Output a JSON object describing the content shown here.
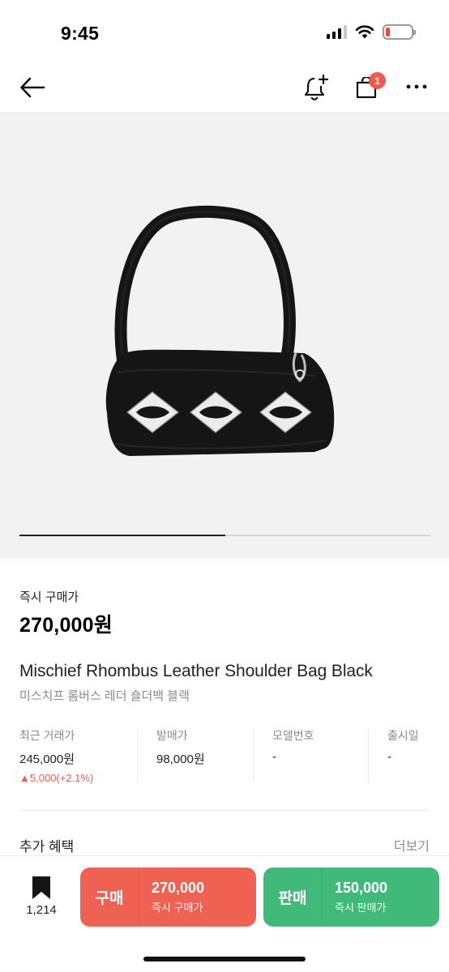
{
  "status_bar": {
    "time": "9:45",
    "icons": [
      "signal-icon",
      "wifi-icon",
      "battery-icon"
    ],
    "battery_level": 0.15,
    "battery_color": "#e94b3c"
  },
  "nav": {
    "icons": [
      "back-arrow-icon",
      "bell-plus-icon",
      "shopping-bag-icon",
      "more-icon"
    ],
    "cart_badge": "1",
    "badge_color": "#ef5a4c"
  },
  "gallery": {
    "progress": 0.5,
    "image": "black-leather-shoulder-bag"
  },
  "price": {
    "label": "즉시 구매가",
    "value": "270,000원"
  },
  "product": {
    "name_en": "Mischief Rhombus Leather Shoulder Bag Black",
    "name_ko": "미스치프 롬버스 레더 숄더백 블랙"
  },
  "details": {
    "recent": {
      "label": "최근 거래가",
      "value": "245,000원",
      "change": "▲5,000(+2.1%)"
    },
    "release_price": {
      "label": "발매가",
      "value": "98,000원"
    },
    "model_no": {
      "label": "모델번호",
      "value": "-"
    },
    "release_date": {
      "label": "출시일",
      "value": "-"
    }
  },
  "benefits": {
    "title": "추가 혜택",
    "more": "더보기"
  },
  "bottom": {
    "bookmark_count": "1,214",
    "buy": {
      "label": "구매",
      "price": "270,000",
      "sub": "즉시 구매가",
      "color": "#ef6253"
    },
    "sell": {
      "label": "판매",
      "price": "150,000",
      "sub": "즉시 판매가",
      "color": "#41b979"
    }
  }
}
